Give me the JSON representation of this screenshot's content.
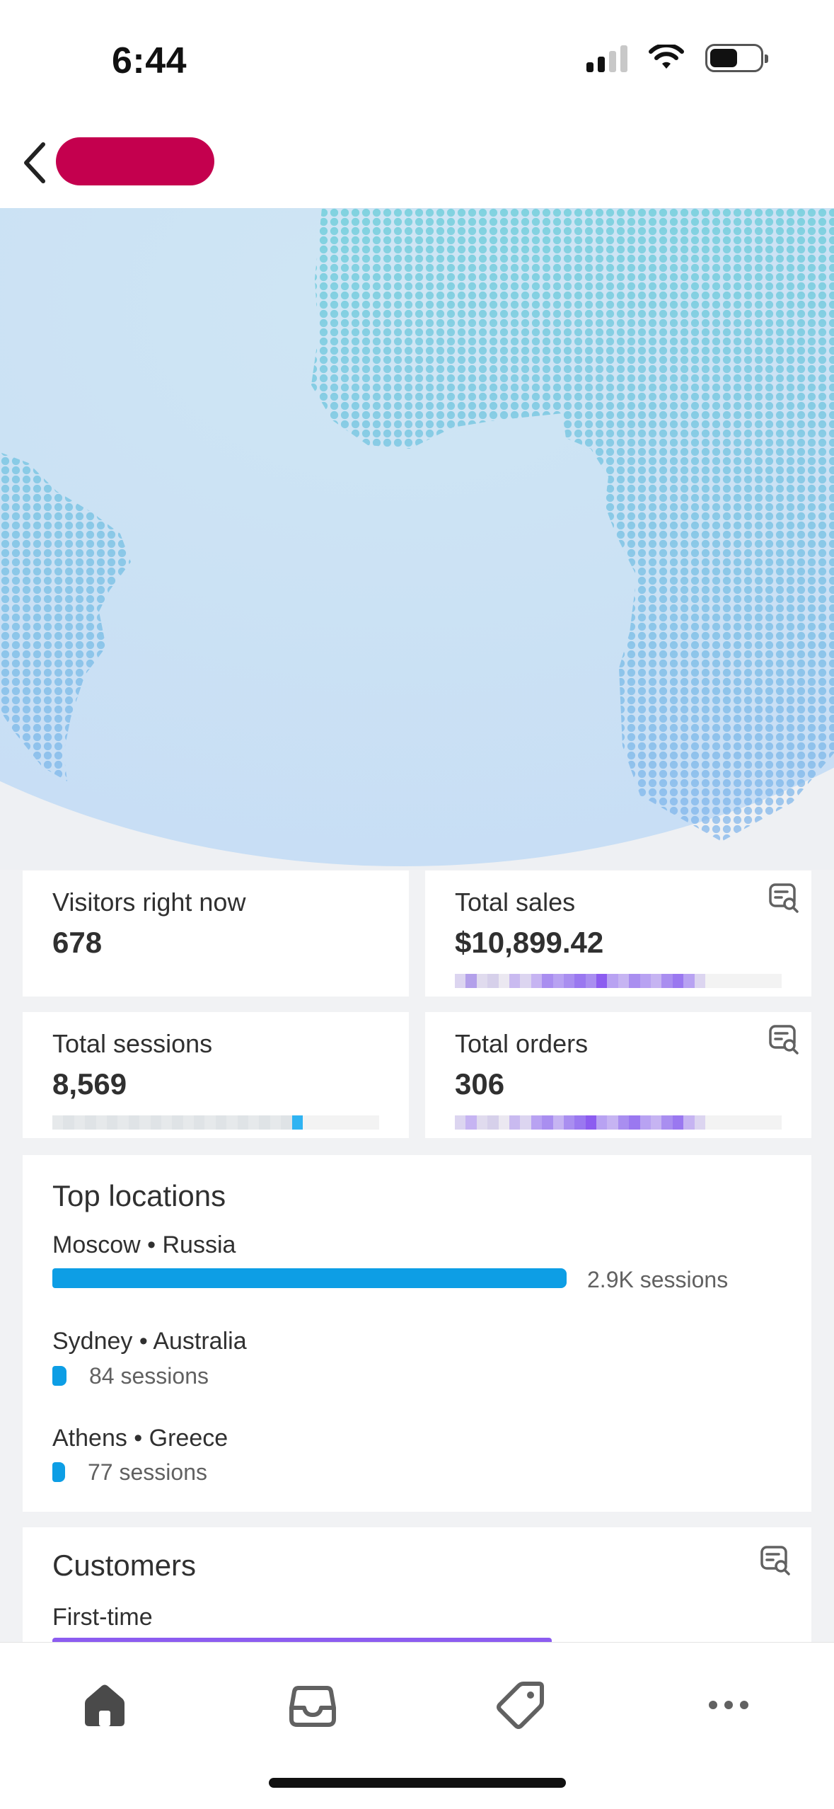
{
  "status_bar": {
    "time": "6:44"
  },
  "hero": {
    "map_colors": [
      "#5fc9d6",
      "#7eb2ec"
    ]
  },
  "metrics": {
    "visitors": {
      "label": "Visitors right now",
      "value": "678"
    },
    "sales": {
      "label": "Total sales",
      "value": "$10,899.42"
    },
    "sessions": {
      "label": "Total sessions",
      "value": "8,569"
    },
    "orders": {
      "label": "Total orders",
      "value": "306"
    }
  },
  "top_locations": {
    "title": "Top locations",
    "items": [
      {
        "name": "Moscow • Russia",
        "sessions": "2.9K sessions",
        "share": 1.0
      },
      {
        "name": "Sydney • Australia",
        "sessions": "84 sessions",
        "share": 0.03
      },
      {
        "name": "Athens • Greece",
        "sessions": "77 sessions",
        "share": 0.027
      }
    ]
  },
  "customers": {
    "title": "Customers",
    "first_time_label": "First-time"
  },
  "tabs": [
    "home-icon",
    "inbox-icon",
    "tag-icon",
    "more-icon"
  ],
  "colors": {
    "accent_blue": "#0d9ee5",
    "brand_pill": "#c4004e",
    "purple": "#8c5cf0"
  }
}
